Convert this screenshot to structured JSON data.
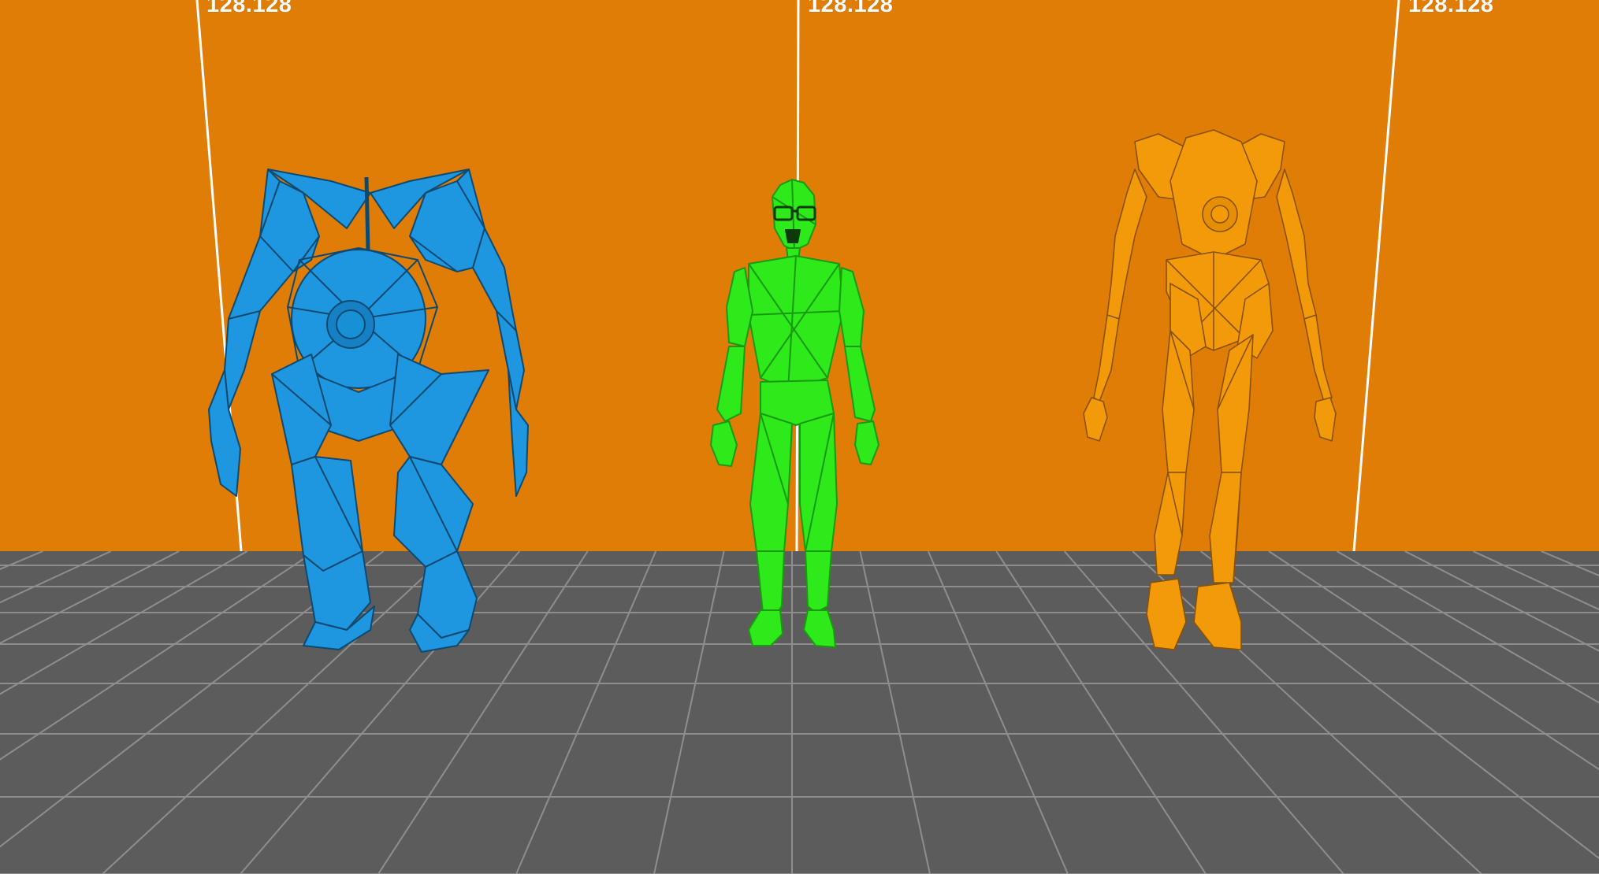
{
  "scene": {
    "background_color": "#E07D07",
    "floor_color": "#5C5C5C",
    "grid_line_color": "#8E8E8E",
    "marker_line_color": "#FFFFFF",
    "height_markers": [
      {
        "label": "128.128"
      },
      {
        "label": "128.128"
      },
      {
        "label": "128.128"
      }
    ],
    "models": [
      {
        "name": "blue-robot",
        "color": "#1E96E0",
        "wire_color": "#0E4A70",
        "render": "wireframe-overlay"
      },
      {
        "name": "green-human",
        "color": "#2EEA1A",
        "wire_color": "#1A9A10",
        "render": "wireframe-overlay"
      },
      {
        "name": "orange-robot",
        "color": "#F29A0A",
        "wire_color": "#8A5200",
        "render": "wireframe-overlay"
      }
    ]
  }
}
